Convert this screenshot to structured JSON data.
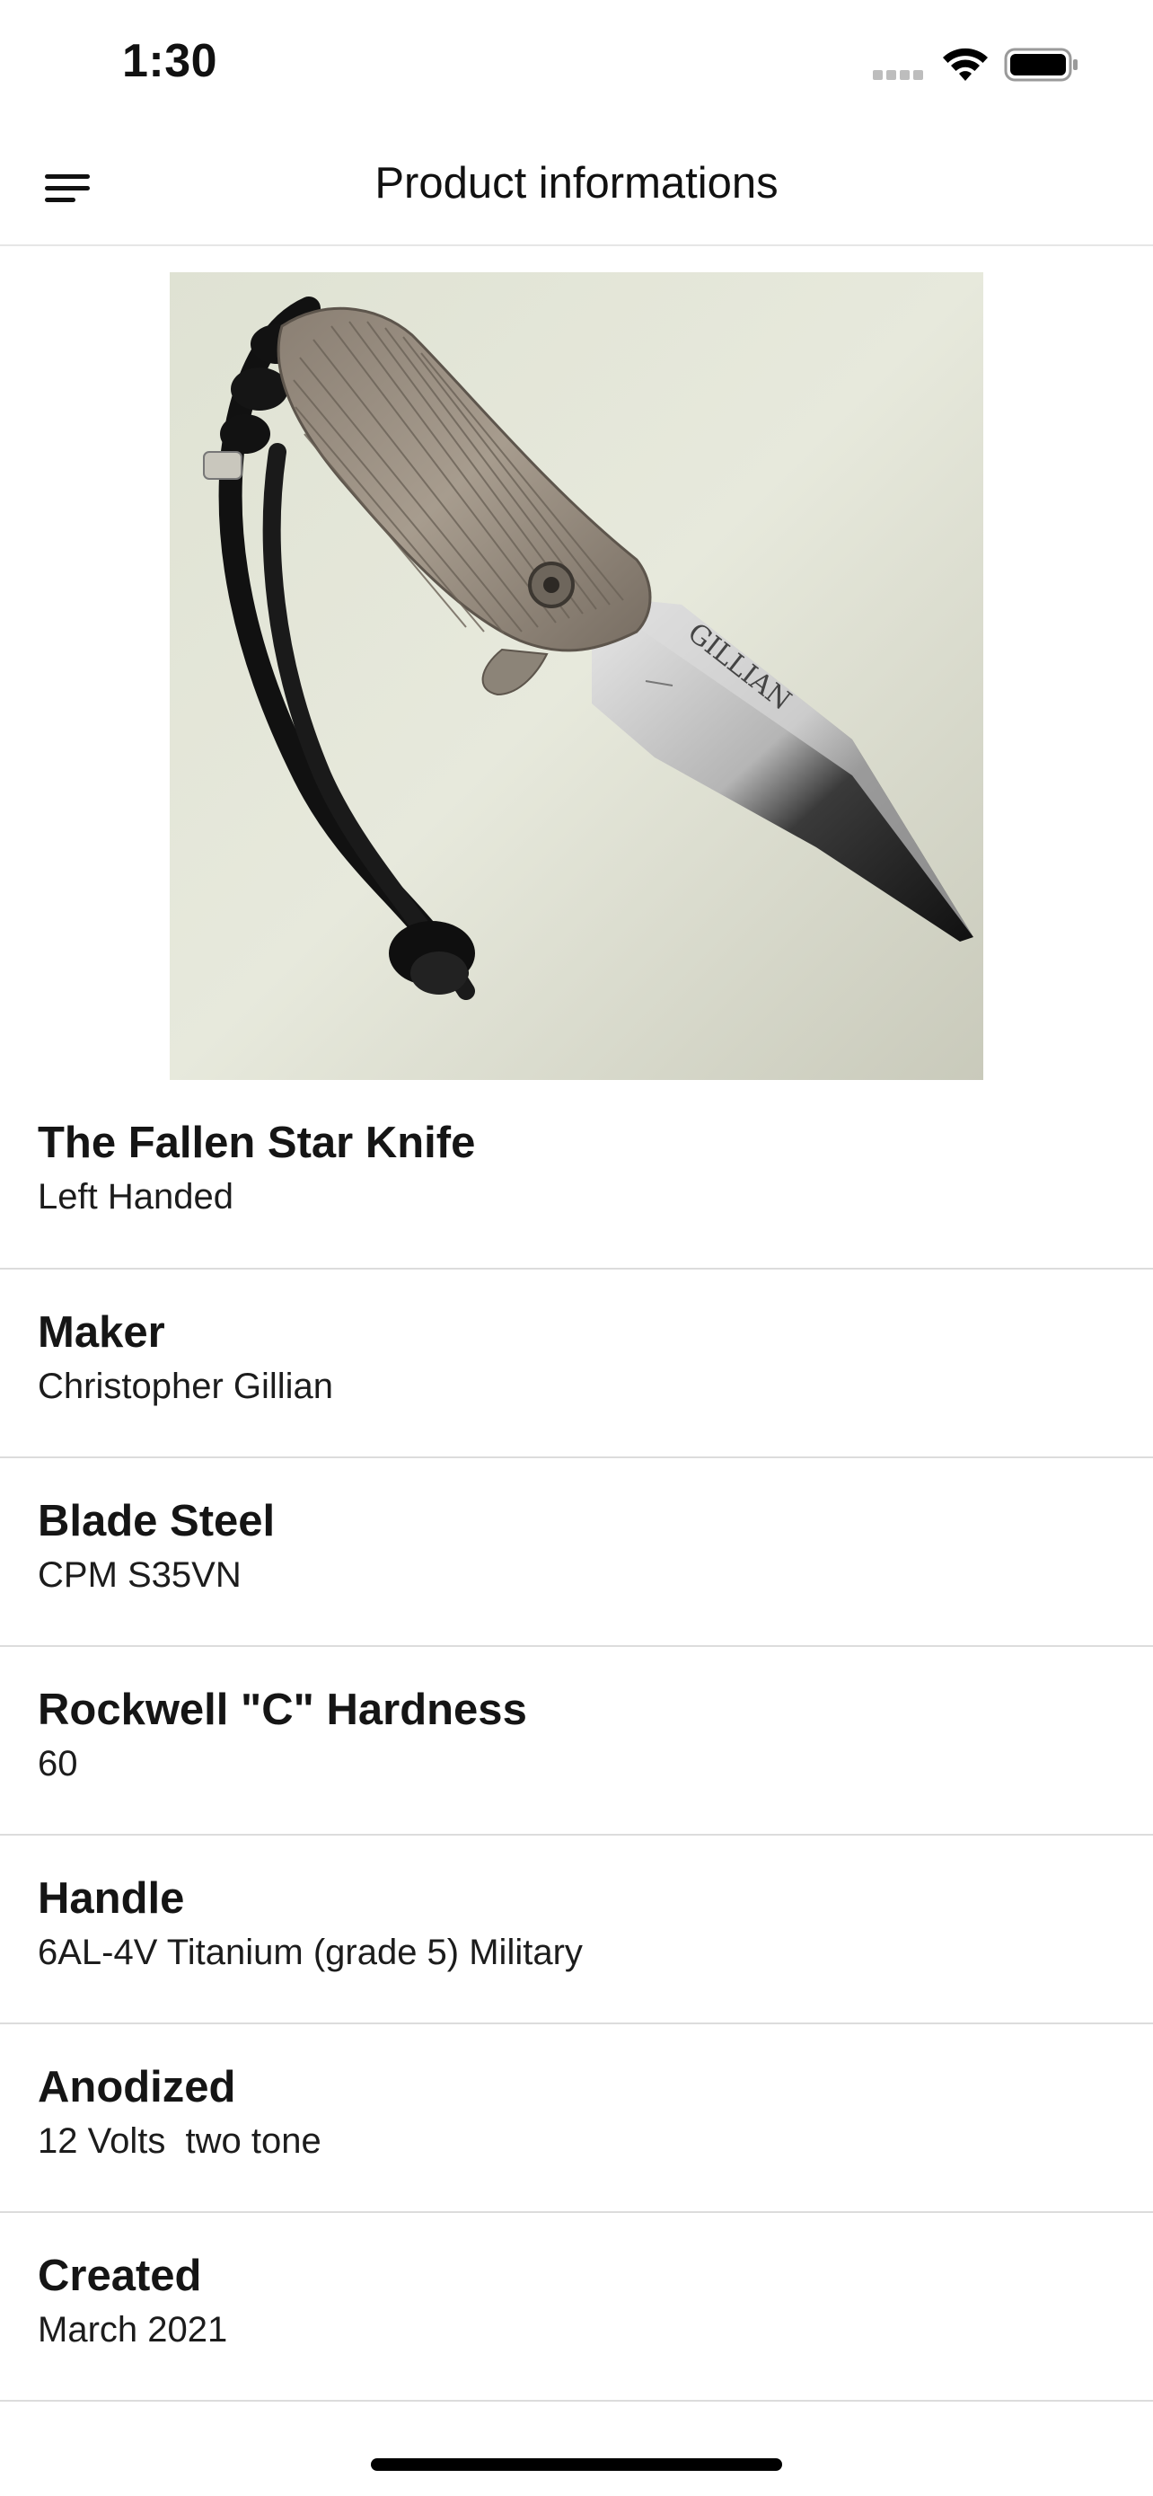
{
  "status_bar": {
    "time": "1:30"
  },
  "header": {
    "title": "Product informations",
    "menu_icon": "hamburger-menu-icon"
  },
  "product": {
    "image_alt": "knife-photo"
  },
  "details": [
    {
      "label": "The Fallen Star Knife",
      "value": "Left Handed"
    },
    {
      "label": "Maker",
      "value": "Christopher Gillian"
    },
    {
      "label": "Blade Steel",
      "value": "CPM S35VN"
    },
    {
      "label": "Rockwell \"C\" Hardness",
      "value": "60"
    },
    {
      "label": "Handle",
      "value": "6AL-4V Titanium (grade 5) Military"
    },
    {
      "label": "Anodized",
      "value": "12 Volts  two tone"
    },
    {
      "label": "Created",
      "value": "March 2021"
    }
  ],
  "image_text": {
    "blade_engraving": "GILLIAN"
  }
}
